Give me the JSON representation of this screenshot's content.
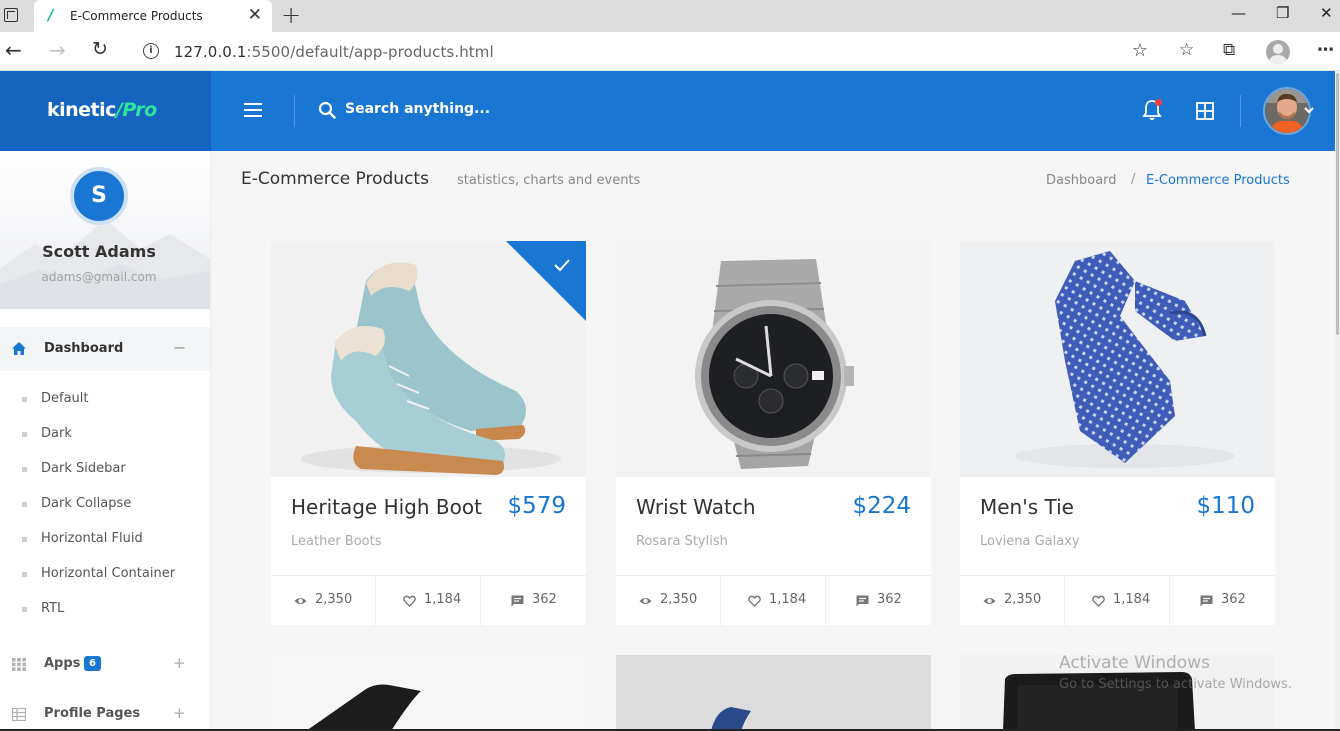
{
  "browser": {
    "tab_title": "E-Commerce Products",
    "tab_favicon": "/",
    "url_host": "127.0.0.1",
    "url_rest": ":5500/default/app-products.html"
  },
  "header": {
    "logo_main": "kinetic",
    "logo_slash": "/",
    "logo_pro": "Pro",
    "search_placeholder": "Search anything..."
  },
  "user": {
    "initial": "S",
    "name": "Scott Adams",
    "email": "adams@gmail.com"
  },
  "sidebar": {
    "active": {
      "label": "Dashboard",
      "toggle": "−"
    },
    "sub_items": [
      {
        "label": "Default"
      },
      {
        "label": "Dark"
      },
      {
        "label": "Dark Sidebar"
      },
      {
        "label": "Dark Collapse"
      },
      {
        "label": "Horizontal Fluid"
      },
      {
        "label": "Horizontal Container"
      },
      {
        "label": "RTL"
      }
    ],
    "groups": [
      {
        "label": "Apps",
        "badge": "6",
        "toggle": "+"
      },
      {
        "label": "Profile Pages",
        "toggle": "+"
      }
    ]
  },
  "page": {
    "title": "E-Commerce Products",
    "subtitle": "statistics, charts and events",
    "breadcrumb": [
      "Dashboard",
      "E-Commerce Products"
    ],
    "breadcrumb_sep": "/"
  },
  "products": [
    {
      "name": "Heritage High Boot",
      "price": "$579",
      "brand": "Leather Boots",
      "views": "2,350",
      "likes": "1,184",
      "comments": "362",
      "selected": true
    },
    {
      "name": "Wrist Watch",
      "price": "$224",
      "brand": "Rosara Stylish",
      "views": "2,350",
      "likes": "1,184",
      "comments": "362",
      "selected": false
    },
    {
      "name": "Men's Tie",
      "price": "$110",
      "brand": "Loviena Galaxy",
      "views": "2,350",
      "likes": "1,184",
      "comments": "362",
      "selected": false
    }
  ],
  "watermark": {
    "line1": "Activate Windows",
    "line2": "Go to Settings to activate Windows."
  },
  "colors": {
    "primary": "#1976d2",
    "logo_bg": "#1565c0",
    "accent_green": "#2ee59d"
  }
}
